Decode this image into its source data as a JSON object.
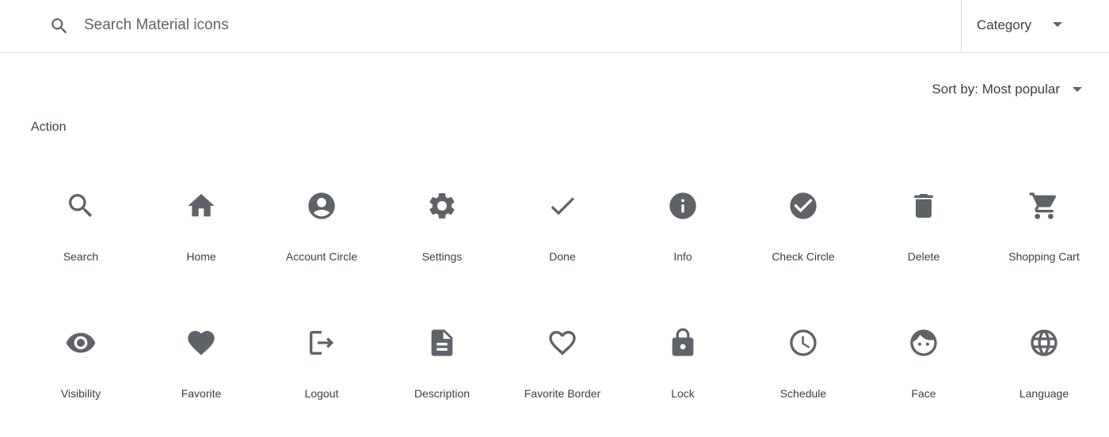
{
  "search": {
    "placeholder": "Search Material icons",
    "value": ""
  },
  "category": {
    "label": "Category"
  },
  "sort": {
    "label": "Sort by: Most popular"
  },
  "section": {
    "title": "Action"
  },
  "icons": [
    {
      "label": "Search",
      "icon": "search-icon"
    },
    {
      "label": "Home",
      "icon": "home-icon"
    },
    {
      "label": "Account Circle",
      "icon": "account-circle-icon"
    },
    {
      "label": "Settings",
      "icon": "settings-icon"
    },
    {
      "label": "Done",
      "icon": "done-icon"
    },
    {
      "label": "Info",
      "icon": "info-icon"
    },
    {
      "label": "Check Circle",
      "icon": "check-circle-icon"
    },
    {
      "label": "Delete",
      "icon": "delete-icon"
    },
    {
      "label": "Shopping Cart",
      "icon": "shopping-cart-icon"
    },
    {
      "label": "Visibility",
      "icon": "visibility-icon"
    },
    {
      "label": "Favorite",
      "icon": "favorite-icon"
    },
    {
      "label": "Logout",
      "icon": "logout-icon"
    },
    {
      "label": "Description",
      "icon": "description-icon"
    },
    {
      "label": "Favorite Border",
      "icon": "favorite-border-icon"
    },
    {
      "label": "Lock",
      "icon": "lock-icon"
    },
    {
      "label": "Schedule",
      "icon": "schedule-icon"
    },
    {
      "label": "Face",
      "icon": "face-icon"
    },
    {
      "label": "Language",
      "icon": "language-icon"
    }
  ],
  "colors": {
    "icon": "#5f6368",
    "text": "#3c4043",
    "divider": "#dadce0"
  }
}
